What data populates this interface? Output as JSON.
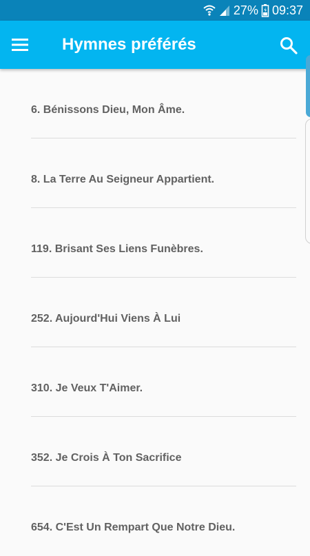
{
  "status_bar": {
    "battery_percent": "27%",
    "time": "09:37",
    "icons": [
      "wifi-icon",
      "signal-icon",
      "battery-icon"
    ]
  },
  "app_bar": {
    "title": "Hymnes préférés",
    "menu_icon": "menu-icon",
    "search_icon": "search-icon"
  },
  "hymns": [
    {
      "label": "6. Bénissons Dieu, Mon Âme."
    },
    {
      "label": "8. La Terre Au Seigneur Appartient."
    },
    {
      "label": "119. Brisant Ses Liens Funèbres."
    },
    {
      "label": "252. Aujourd'Hui Viens À Lui"
    },
    {
      "label": "310. Je Veux T'Aimer."
    },
    {
      "label": "352. Je Crois À Ton Sacrifice"
    },
    {
      "label": "654. C'Est Un Rempart Que Notre Dieu."
    }
  ],
  "colors": {
    "status_bar": "#0a83b9",
    "app_bar": "#03b5f0",
    "background": "#fafafa",
    "text": "#616161",
    "divider": "#dcdcdc"
  }
}
